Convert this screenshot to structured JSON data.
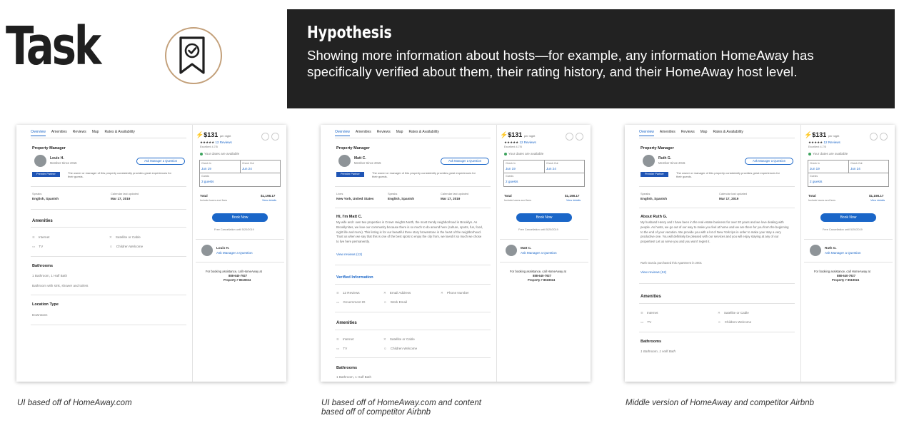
{
  "header": {
    "task_label": "Task",
    "hypothesis_title": "Hypothesis",
    "hypothesis_text": "Showing more information about hosts—for example, any information HomeAway has specifically verified about them, their rating history, and their HomeAway host level."
  },
  "colors": {
    "accent": "#1a66c8",
    "dark_panel": "#222222",
    "badge_ring": "#c3a07a"
  },
  "icons": [
    "badge-check-icon",
    "lightning-icon",
    "share-icon",
    "heart-icon",
    "wifi-icon",
    "satellite-icon",
    "tv-icon",
    "children-icon",
    "phone-icon",
    "email-icon",
    "id-icon"
  ],
  "common": {
    "tabs": [
      "Overview",
      "Amenities",
      "Reviews",
      "Map",
      "Rates & Availability"
    ],
    "property_manager": "Property Manager",
    "member_since": "Member Since 2015",
    "ask_button": "Ask Manager a Question",
    "premier": "Premier Partner",
    "premier_desc": "The owner or manager of this property consistently provides great experiences for their guests.",
    "speaks_label": "Speaks",
    "speaks_value": "English, Spanish",
    "calendar_label": "Calendar last updated",
    "calendar_value": "Mar 17, 2019",
    "amenities": "Amenities",
    "internet": "Internet",
    "satellite": "Satellite or Cable",
    "tv": "TV",
    "children": "Children Welcome",
    "bathrooms": "Bathrooms",
    "bath_value": "1 Bathroom, 1 Half Bath",
    "price": "$131",
    "per_night": "per night",
    "stars": "★★★★★",
    "reviews_count": "12 Reviews",
    "excellent": "Excellent 4.7/5",
    "dates_available": "Your dates are available",
    "check_in": "Check In",
    "check_in_val": "Jun 19",
    "check_out": "Check Out",
    "check_out_val": "Jun 24",
    "guests": "Guests",
    "guests_val_3": "3 guests",
    "guests_val_2": "2 guests",
    "total": "Total",
    "total_val": "$1,198.17",
    "taxes": "Include taxes and fees",
    "view_details": "View details",
    "book_now": "Book Now",
    "free_cancel": "Free Cancellation until 5/20/2019",
    "assist": "For booking assistance, call HomeAway at",
    "phone": "888-640-7927",
    "property_no": "Property # 8519024",
    "view_reviews": "View reviews (12)"
  },
  "mock1": {
    "host": "Louis H.",
    "bath_desc": "Bathroom with sink, shower and toilets",
    "location_type": "Location Type",
    "location_value": "Downtown",
    "caption": "UI based off of HomeAway.com"
  },
  "mock2": {
    "host": "Matt C.",
    "lives_label": "Lives",
    "lives_value": "New York, United States",
    "about_title": "Hi, I'm Matt C.",
    "about_text": "My wife and I own two properties in Crown Heights North, the most trendy neighborhood in Brooklyn. As Brooklynites, we love our community because there is so much to do around here (culture, sports, fun, food, night life and more). This listing is for our beautiful three story brownstone in the heart of the neighborhood. Trust us when we say that this is one of the best spots to enjoy the city from, we loved it so much we chose to live here permanently.",
    "verified_title": "Verified Information",
    "verified": [
      "12 Reviews",
      "Email Address",
      "Phone Number",
      "Government ID",
      "Work Email"
    ],
    "caption": "UI based off of HomeAway.com and content based off of competitor Airbnb"
  },
  "mock3": {
    "host": "Ruth G.",
    "about_title": "About Ruth G.",
    "about_text": "My husband Henry and I have been in the real estate business for over 20 years and we love dealing with people. As hosts, we go out of our way to make you feel at home and we are there for you from the beginning to the end of your vacation. We provide you with a lot of New York tips in order to make your stay a very productive one. You will definitely be pleased with our services and you will enjoy staying at any of our properties! Let us serve you and you won't regret it.",
    "purchased": "Ruth Garcia purchased this Apartment in 2001",
    "bath_value": "1 Bathroom, 1 Half Bath",
    "caption": "Middle version of HomeAway and competitor Airbnb"
  }
}
